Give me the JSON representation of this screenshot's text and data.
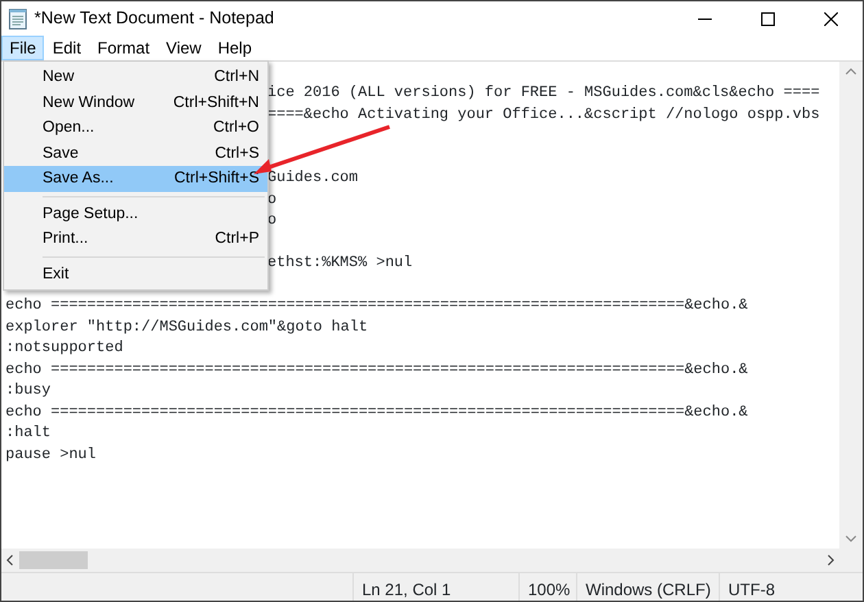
{
  "window": {
    "title": "*New Text Document - Notepad"
  },
  "menubar": [
    {
      "label": "File",
      "selected": true
    },
    {
      "label": "Edit",
      "selected": false
    },
    {
      "label": "Format",
      "selected": false
    },
    {
      "label": "View",
      "selected": false
    },
    {
      "label": "Help",
      "selected": false
    }
  ],
  "file_menu": [
    {
      "kind": "item",
      "label": "New",
      "shortcut": "Ctrl+N",
      "selected": false
    },
    {
      "kind": "item",
      "label": "New Window",
      "shortcut": "Ctrl+Shift+N",
      "selected": false
    },
    {
      "kind": "item",
      "label": "Open...",
      "shortcut": "Ctrl+O",
      "selected": false
    },
    {
      "kind": "item",
      "label": "Save",
      "shortcut": "Ctrl+S",
      "selected": false
    },
    {
      "kind": "item",
      "label": "Save As...",
      "shortcut": "Ctrl+Shift+S",
      "selected": true
    },
    {
      "kind": "separator"
    },
    {
      "kind": "item",
      "label": "Page Setup...",
      "selected": false
    },
    {
      "kind": "item",
      "label": "Print...",
      "shortcut": "Ctrl+P",
      "selected": false
    },
    {
      "kind": "separator"
    },
    {
      "kind": "item",
      "label": "Exit",
      "selected": false
    }
  ],
  "editor": {
    "lines_beside_menu": [
      {
        "kind": "text",
        "text": "ice 2016 (ALL versions) for FREE - MSGuides.com&cls&echo ===="
      },
      {
        "kind": "text",
        "text": "====&echo Activating your Office...&cscript //nologo ospp.vbs"
      },
      {
        "kind": "blank"
      },
      {
        "kind": "blank"
      },
      {
        "kind": "text",
        "text": "Guides.com"
      },
      {
        "kind": "text",
        "text": "o"
      },
      {
        "kind": "text",
        "text": "o"
      },
      {
        "kind": "blank"
      },
      {
        "kind": "text",
        "text": "ethst:%KMS% >nul"
      },
      {
        "kind": "blank"
      }
    ],
    "lines": [
      {
        "kind": "text",
        "text": "echo ======================================================================&echo.&"
      },
      {
        "kind": "text",
        "text": "explorer \"http://MSGuides.com\"&goto halt"
      },
      {
        "kind": "text",
        "text": ":notsupported"
      },
      {
        "kind": "text",
        "text": "echo ======================================================================&echo.&"
      },
      {
        "kind": "text",
        "text": ":busy"
      },
      {
        "kind": "text",
        "text": "echo ======================================================================&echo.&"
      },
      {
        "kind": "text",
        "text": ":halt"
      },
      {
        "kind": "text",
        "text": "pause >nul"
      }
    ]
  },
  "status_bar": {
    "position": "Ln 21, Col 1",
    "zoom": "100%",
    "line_ending": "Windows (CRLF)",
    "encoding": "UTF-8"
  }
}
